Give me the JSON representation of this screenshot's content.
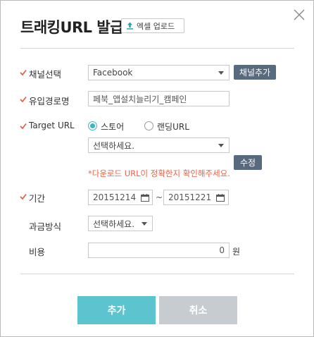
{
  "dialog": {
    "title": "트래킹URL 발급",
    "excel_upload_label": "엑셀 업로드"
  },
  "form": {
    "channel": {
      "label": "채널선택",
      "value": "Facebook",
      "add_button": "채널추가"
    },
    "inflow_name": {
      "label": "유입경로명",
      "value": "페북_앱설치늘리기_캠페인"
    },
    "target_url": {
      "label": "Target URL",
      "options": [
        "스토어",
        "랜딩URL"
      ],
      "selected": "스토어",
      "select_value": "선택하세요.",
      "edit_button": "수정",
      "warning": "*다운로드 URL이 정확한지 확인해주세요."
    },
    "period": {
      "label": "기간",
      "start": "20151214",
      "end": "20151221",
      "separator": "~"
    },
    "billing": {
      "label": "과금방식",
      "value": "선택하세요."
    },
    "cost": {
      "label": "비용",
      "value": "0",
      "unit": "원"
    }
  },
  "actions": {
    "confirm": "추가",
    "cancel": "취소"
  },
  "colors": {
    "primary": "#5bc4cf",
    "cancel": "#c7ccd1",
    "dark_button": "#5a6a7e",
    "required_check": "#e35a3a",
    "warning": "#e8634a"
  }
}
